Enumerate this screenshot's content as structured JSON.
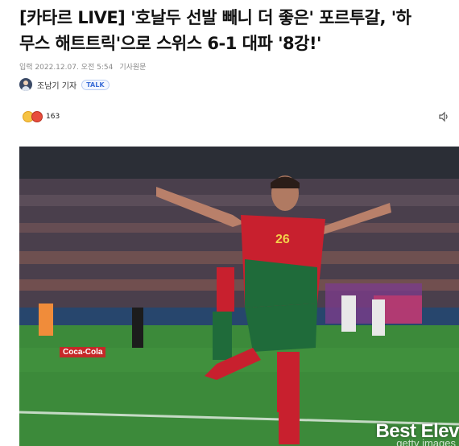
{
  "article": {
    "headline_line1": "[카타르 LIVE] '호날두 선발 빼니 더 좋은' 포르투갈, '하",
    "headline_line2": "무스 해트트릭'으로 스위스 6-1 대파 '8강!'",
    "meta": {
      "input_label": "입력 2022.12.07. 오전 5:54",
      "original_link": "기사원문"
    },
    "byline": {
      "reporter": "조남기 기자",
      "talk_badge": "TALK"
    },
    "reactions": {
      "count": "163"
    },
    "photo": {
      "watermark": "Best Elev",
      "credit": "getty images",
      "adboard_text": "Coca-Cola",
      "jersey_number": "26"
    }
  },
  "colors": {
    "talk_badge": "#3d6fd8",
    "jersey_red": "#c8202e",
    "jersey_green": "#1f6b3a"
  },
  "icons": {
    "speaker": "speaker-icon",
    "reaction": "emoji-reaction-icon"
  }
}
